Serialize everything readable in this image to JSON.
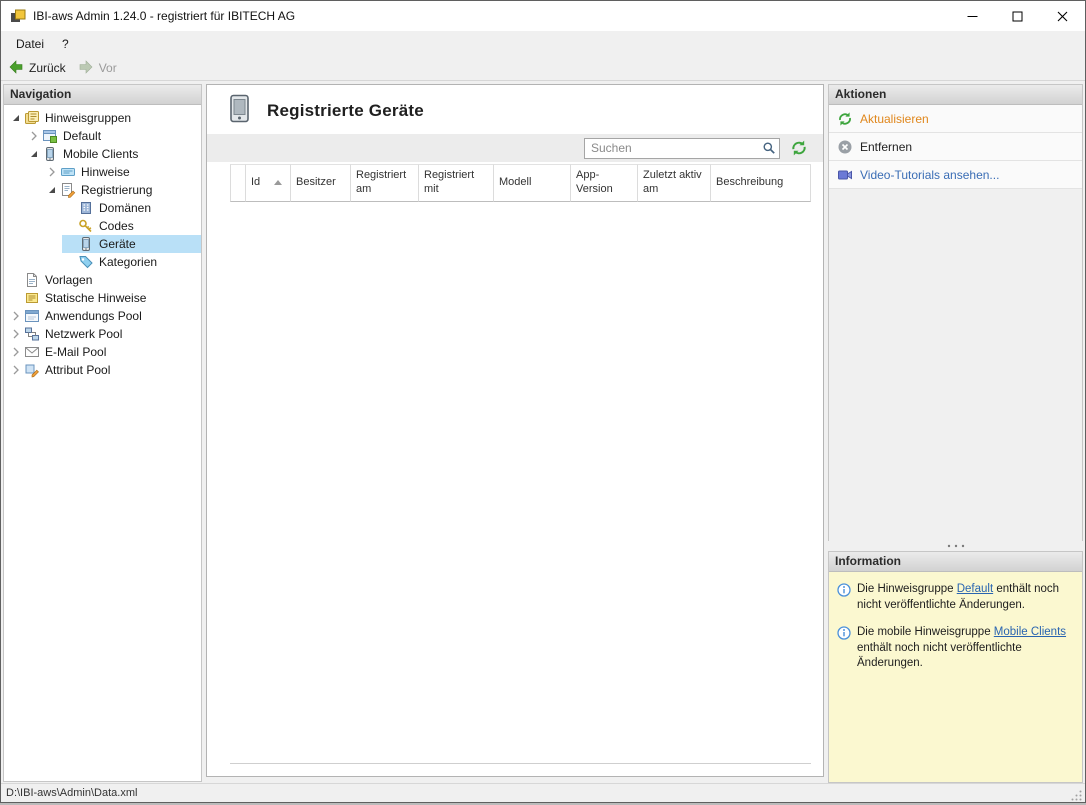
{
  "window": {
    "title": "IBI-aws Admin 1.24.0 - registriert für IBITECH AG",
    "controls": [
      "minimize-icon",
      "maximize-icon",
      "close-icon"
    ]
  },
  "menubar": {
    "items": [
      {
        "label": "Datei"
      },
      {
        "label": "?"
      }
    ]
  },
  "toolbar": {
    "back_label": "Zurück",
    "forward_label": "Vor",
    "forward_enabled": false
  },
  "navigation": {
    "header": "Navigation",
    "tree": [
      {
        "label": "Hinweisgruppen",
        "level": 0,
        "state": "expanded",
        "icon": "hint-groups-icon",
        "selected": false
      },
      {
        "label": "Default",
        "level": 1,
        "state": "collapsed",
        "icon": "default-group-icon",
        "selected": false
      },
      {
        "label": "Mobile Clients",
        "level": 1,
        "state": "expanded",
        "icon": "mobile-clients-icon",
        "selected": false
      },
      {
        "label": "Hinweise",
        "level": 2,
        "state": "collapsed",
        "icon": "hints-icon",
        "selected": false
      },
      {
        "label": "Registrierung",
        "level": 2,
        "state": "expanded",
        "icon": "registration-icon",
        "selected": false
      },
      {
        "label": "Domänen",
        "level": 3,
        "state": "leaf",
        "icon": "domains-icon",
        "selected": false
      },
      {
        "label": "Codes",
        "level": 3,
        "state": "leaf",
        "icon": "codes-icon",
        "selected": false
      },
      {
        "label": "Geräte",
        "level": 3,
        "state": "leaf",
        "icon": "devices-icon",
        "selected": true
      },
      {
        "label": "Kategorien",
        "level": 3,
        "state": "leaf",
        "icon": "categories-icon",
        "selected": false
      },
      {
        "label": "Vorlagen",
        "level": 0,
        "state": "leaf",
        "icon": "templates-icon",
        "selected": false
      },
      {
        "label": "Statische Hinweise",
        "level": 0,
        "state": "leaf",
        "icon": "static-hints-icon",
        "selected": false
      },
      {
        "label": "Anwendungs Pool",
        "level": 0,
        "state": "collapsed",
        "icon": "applications-pool-icon",
        "selected": false
      },
      {
        "label": "Netzwerk Pool",
        "level": 0,
        "state": "collapsed",
        "icon": "network-pool-icon",
        "selected": false
      },
      {
        "label": "E-Mail Pool",
        "level": 0,
        "state": "collapsed",
        "icon": "email-pool-icon",
        "selected": false
      },
      {
        "label": "Attribut Pool",
        "level": 0,
        "state": "collapsed",
        "icon": "attribute-pool-icon",
        "selected": false
      }
    ]
  },
  "main": {
    "title": "Registrierte Geräte",
    "title_icon": "mobile-device-icon",
    "search": {
      "placeholder": "Suchen"
    },
    "table": {
      "columns": [
        "Id",
        "Besitzer",
        "Registriert am",
        "Registriert mit",
        "Modell",
        "App-Version",
        "Zuletzt aktiv am",
        "Beschreibung"
      ],
      "sort": {
        "column": "Id",
        "direction": "asc"
      },
      "rows": []
    }
  },
  "actions": {
    "header": "Aktionen",
    "items": [
      {
        "label": "Aktualisieren",
        "icon": "refresh-icon",
        "color": "#e0871c"
      },
      {
        "label": "Entfernen",
        "icon": "remove-icon",
        "color": "#222222"
      },
      {
        "label": "Video-Tutorials ansehen...",
        "icon": "video-icon",
        "color": "#3a6db5"
      }
    ]
  },
  "information": {
    "header": "Information",
    "notes": [
      {
        "prefix": "Die Hinweisgruppe ",
        "link": "Default",
        "suffix": " enthält noch nicht veröffentlichte Änderungen."
      },
      {
        "prefix": "Die mobile Hinweisgruppe ",
        "link": "Mobile Clients",
        "suffix": " enthält noch nicht veröffentlichte Änderungen."
      }
    ]
  },
  "statusbar": {
    "path": "D:\\IBI-aws\\Admin\\Data.xml"
  },
  "colors": {
    "selection_bg": "#b9e0f7",
    "action_highlight": "#e0871c",
    "link_blue": "#2964b0",
    "info_panel_bg": "#fbf8d0",
    "refresh_green": "#3da53d"
  }
}
